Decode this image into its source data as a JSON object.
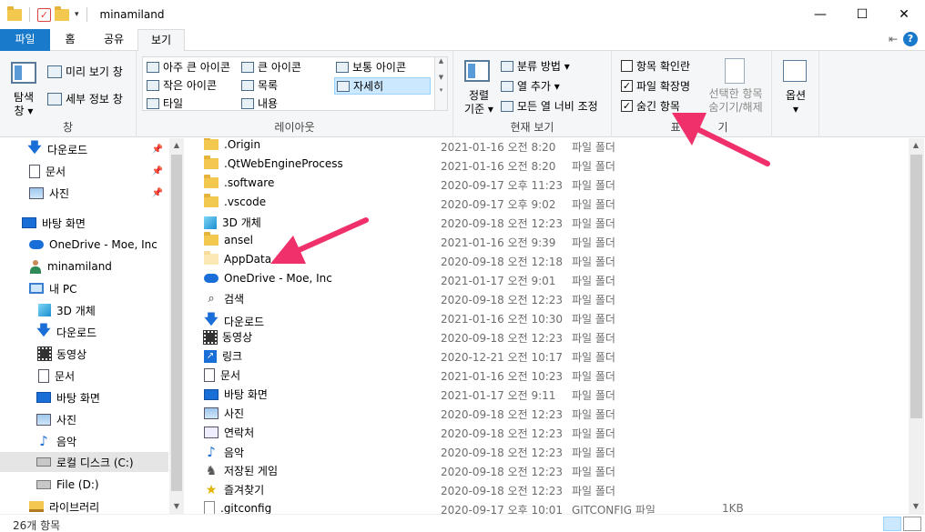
{
  "window": {
    "title": "minamiland",
    "minimize": "—",
    "maximize": "☐",
    "close": "✕",
    "quick_access_dropdown": "▾"
  },
  "tabs": {
    "file": "파일",
    "home": "홈",
    "share": "공유",
    "view": "보기"
  },
  "ribbon": {
    "pane": {
      "nav_pane_line1": "탐색",
      "nav_pane_line2": "창 ▾",
      "preview": "미리 보기 창",
      "details": "세부 정보 창",
      "label": "창"
    },
    "layout": {
      "items": [
        "아주 큰 아이콘",
        "큰 아이콘",
        "보통 아이콘",
        "작은 아이콘",
        "목록",
        "자세히",
        "타일",
        "내용"
      ],
      "label": "레이아웃"
    },
    "current_view": {
      "sort_line1": "정렬",
      "sort_line2": "기준 ▾",
      "group_by": "분류 방법 ▾",
      "add_column": "열 추가 ▾",
      "fit_columns": "모든 열 너비 조정",
      "label": "현재 보기"
    },
    "show_hide": {
      "item_checkboxes": "항목 확인란",
      "file_extensions": "파일 확장명",
      "hidden_items": "숨긴 항목",
      "hide_selected_line1": "선택한 항목",
      "hide_selected_line2": "숨기기/해제",
      "label": "표시/숨기기",
      "label_visible": "표",
      "label_visible_tail": "기"
    },
    "options": {
      "label": "옵션",
      "arrow": "▾"
    }
  },
  "nav": {
    "items": [
      {
        "label": "다운로드",
        "icon": "download-icon"
      },
      {
        "label": "문서",
        "icon": "document-icon"
      },
      {
        "label": "사진",
        "icon": "pictures-icon"
      },
      {
        "label": "바탕 화면",
        "icon": "desktop-icon"
      },
      {
        "label": "OneDrive - Moe, Inc",
        "icon": "onedrive-icon"
      },
      {
        "label": "minamiland",
        "icon": "user-icon"
      },
      {
        "label": "내 PC",
        "icon": "pc-icon"
      },
      {
        "label": "3D 개체",
        "icon": "3d-objects-icon"
      },
      {
        "label": "다운로드",
        "icon": "download-icon"
      },
      {
        "label": "동영상",
        "icon": "videos-icon"
      },
      {
        "label": "문서",
        "icon": "document-icon"
      },
      {
        "label": "바탕 화면",
        "icon": "desktop-icon"
      },
      {
        "label": "사진",
        "icon": "pictures-icon"
      },
      {
        "label": "음악",
        "icon": "music-icon"
      },
      {
        "label": "로컬 디스크 (C:)",
        "icon": "local-disk-icon"
      },
      {
        "label": "File (D:)",
        "icon": "drive-icon"
      },
      {
        "label": "라이브러리",
        "icon": "library-icon"
      }
    ]
  },
  "files": [
    {
      "name": ".Origin",
      "date": "2021-01-16 오전 8:20",
      "type": "파일 폴더",
      "size": "",
      "icon": "folder"
    },
    {
      "name": ".QtWebEngineProcess",
      "date": "2021-01-16 오전 8:20",
      "type": "파일 폴더",
      "size": "",
      "icon": "folder"
    },
    {
      "name": ".software",
      "date": "2020-09-17 오후 11:23",
      "type": "파일 폴더",
      "size": "",
      "icon": "folder"
    },
    {
      "name": ".vscode",
      "date": "2020-09-17 오후 9:02",
      "type": "파일 폴더",
      "size": "",
      "icon": "folder"
    },
    {
      "name": "3D 개체",
      "date": "2020-09-18 오전 12:23",
      "type": "파일 폴더",
      "size": "",
      "icon": "3d"
    },
    {
      "name": "ansel",
      "date": "2021-01-16 오전 9:39",
      "type": "파일 폴더",
      "size": "",
      "icon": "folder"
    },
    {
      "name": "AppData",
      "date": "2020-09-18 오전 12:18",
      "type": "파일 폴더",
      "size": "",
      "icon": "folder-faint"
    },
    {
      "name": "OneDrive - Moe, Inc",
      "date": "2021-01-17 오전 9:01",
      "type": "파일 폴더",
      "size": "",
      "icon": "cloud"
    },
    {
      "name": "검색",
      "date": "2020-09-18 오전 12:23",
      "type": "파일 폴더",
      "size": "",
      "icon": "search"
    },
    {
      "name": "다운로드",
      "date": "2021-01-16 오전 10:30",
      "type": "파일 폴더",
      "size": "",
      "icon": "down"
    },
    {
      "name": "동영상",
      "date": "2020-09-18 오전 12:23",
      "type": "파일 폴더",
      "size": "",
      "icon": "film"
    },
    {
      "name": "링크",
      "date": "2020-12-21 오전 10:17",
      "type": "파일 폴더",
      "size": "",
      "icon": "link"
    },
    {
      "name": "문서",
      "date": "2021-01-16 오전 10:23",
      "type": "파일 폴더",
      "size": "",
      "icon": "doc"
    },
    {
      "name": "바탕 화면",
      "date": "2021-01-17 오전 9:11",
      "type": "파일 폴더",
      "size": "",
      "icon": "desk"
    },
    {
      "name": "사진",
      "date": "2020-09-18 오전 12:23",
      "type": "파일 폴더",
      "size": "",
      "icon": "pic"
    },
    {
      "name": "연락처",
      "date": "2020-09-18 오전 12:23",
      "type": "파일 폴더",
      "size": "",
      "icon": "contact"
    },
    {
      "name": "음악",
      "date": "2020-09-18 오전 12:23",
      "type": "파일 폴더",
      "size": "",
      "icon": "music"
    },
    {
      "name": "저장된 게임",
      "date": "2020-09-18 오전 12:23",
      "type": "파일 폴더",
      "size": "",
      "icon": "game"
    },
    {
      "name": "즐겨찾기",
      "date": "2020-09-18 오전 12:23",
      "type": "파일 폴더",
      "size": "",
      "icon": "star"
    },
    {
      "name": ".gitconfig",
      "date": "2020-09-17 오후 10:01",
      "type": "GITCONFIG 파일",
      "size": "1KB",
      "icon": "file"
    }
  ],
  "status": {
    "item_count": "26개 항목"
  },
  "colors": {
    "accent": "#1979ca",
    "annotation_arrow": "#f0306b"
  }
}
